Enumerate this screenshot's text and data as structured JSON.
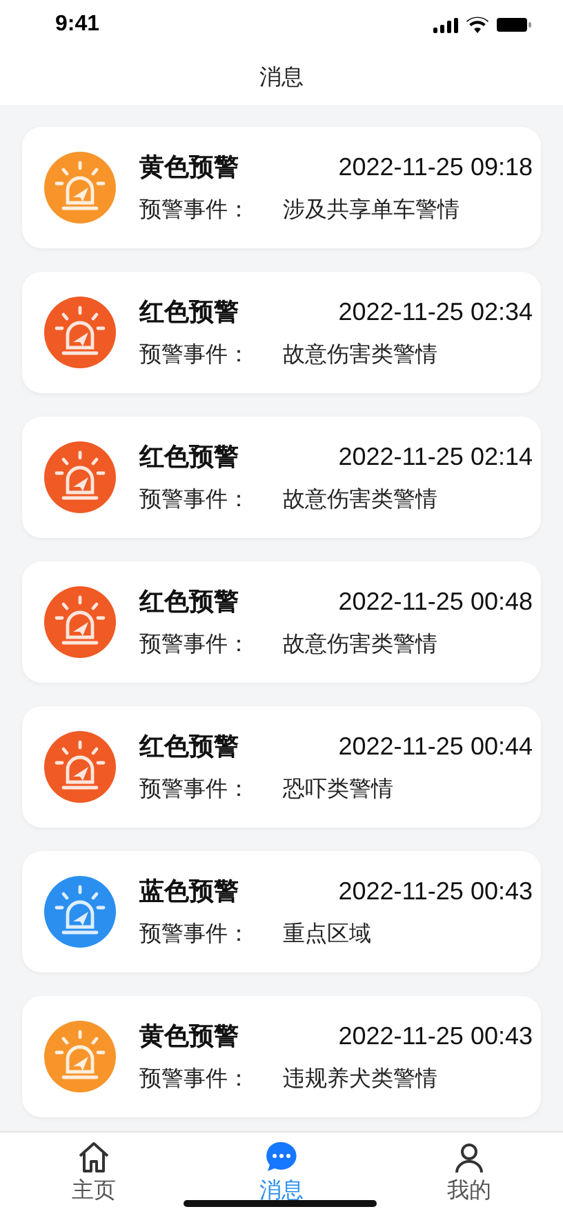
{
  "status_bar": {
    "time": "9:41"
  },
  "header": {
    "title": "消息"
  },
  "messages": [
    {
      "level_title": "黄色预警",
      "time": "2022-11-25 09:18",
      "label": "预警事件：",
      "event": "涉及共享单车警情",
      "color": "#f7952b"
    },
    {
      "level_title": "红色预警",
      "time": "2022-11-25 02:34",
      "label": "预警事件：",
      "event": "故意伤害类警情",
      "color": "#f05a24"
    },
    {
      "level_title": "红色预警",
      "time": "2022-11-25 02:14",
      "label": "预警事件：",
      "event": "故意伤害类警情",
      "color": "#f05a24"
    },
    {
      "level_title": "红色预警",
      "time": "2022-11-25 00:48",
      "label": "预警事件：",
      "event": "故意伤害类警情",
      "color": "#f05a24"
    },
    {
      "level_title": "红色预警",
      "time": "2022-11-25 00:44",
      "label": "预警事件：",
      "event": "恐吓类警情",
      "color": "#f05a24"
    },
    {
      "level_title": "蓝色预警",
      "time": "2022-11-25 00:43",
      "label": "预警事件：",
      "event": "重点区域",
      "color": "#2b8ff0"
    },
    {
      "level_title": "黄色预警",
      "time": "2022-11-25 00:43",
      "label": "预警事件：",
      "event": "违规养犬类警情",
      "color": "#f7952b"
    }
  ],
  "tab_bar": [
    {
      "label": "主页",
      "kind": "home",
      "selected": false
    },
    {
      "label": "消息",
      "kind": "chat",
      "selected": true
    },
    {
      "label": "我的",
      "kind": "person",
      "selected": false
    }
  ]
}
